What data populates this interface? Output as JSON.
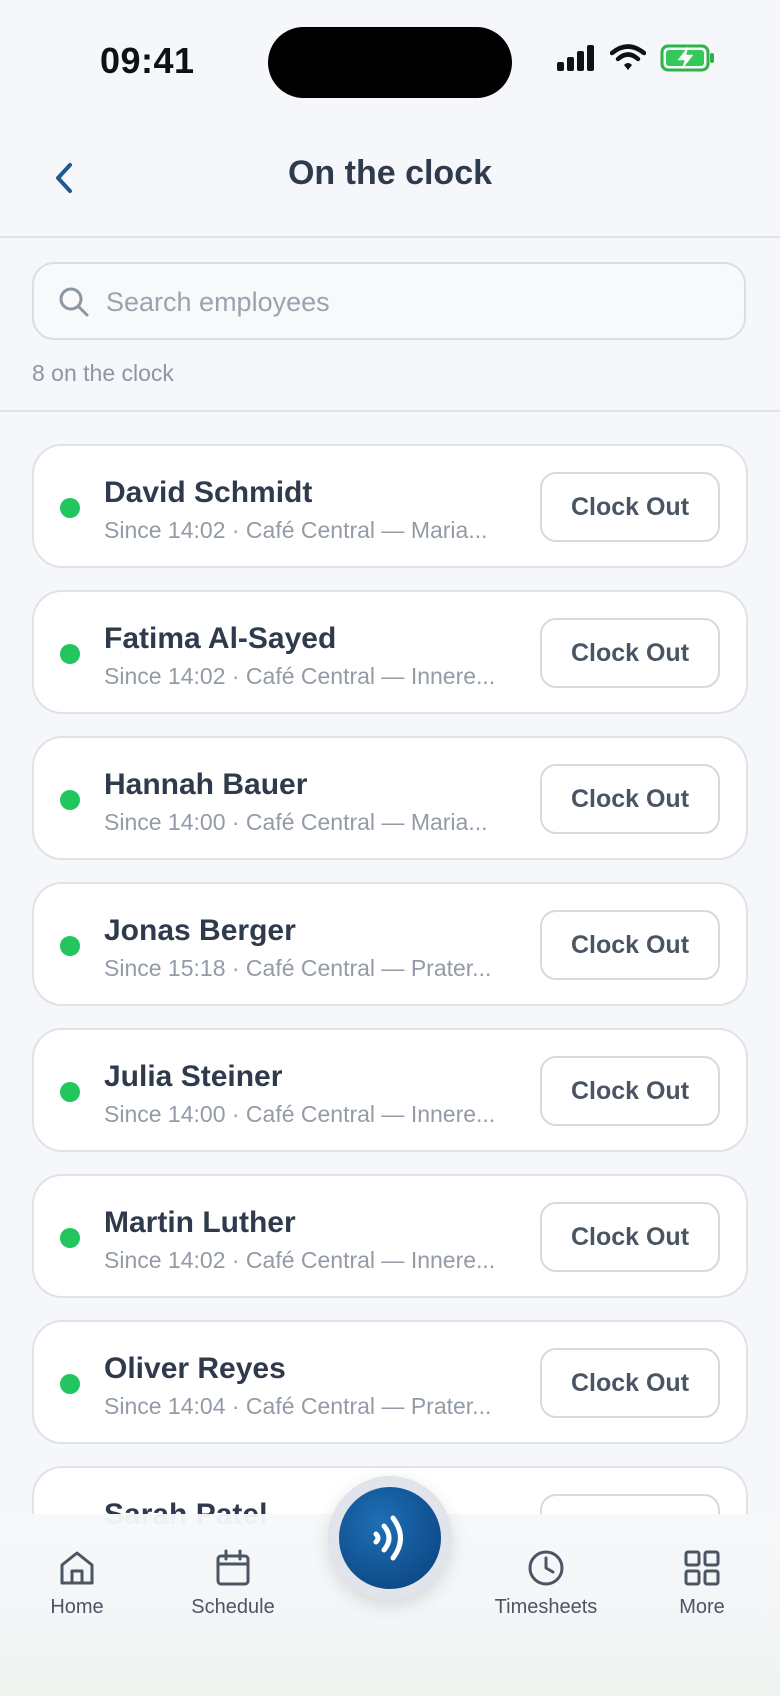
{
  "status_bar": {
    "time": "09:41"
  },
  "header": {
    "title": "On the clock"
  },
  "search": {
    "placeholder": "Search employees",
    "value": ""
  },
  "summary": {
    "count_label": "8 on the clock"
  },
  "employees": [
    {
      "name": "David Schmidt",
      "meta": "Since 14:02 · Café Central — Maria...",
      "action": "Clock Out"
    },
    {
      "name": "Fatima Al-Sayed",
      "meta": "Since 14:02 · Café Central — Innere...",
      "action": "Clock Out"
    },
    {
      "name": "Hannah Bauer",
      "meta": "Since 14:00 · Café Central — Maria...",
      "action": "Clock Out"
    },
    {
      "name": "Jonas Berger",
      "meta": "Since 15:18 · Café Central — Prater...",
      "action": "Clock Out"
    },
    {
      "name": "Julia Steiner",
      "meta": "Since 14:00 · Café Central — Innere...",
      "action": "Clock Out"
    },
    {
      "name": "Martin Luther",
      "meta": "Since 14:02 · Café Central — Innere...",
      "action": "Clock Out"
    },
    {
      "name": "Oliver Reyes",
      "meta": "Since 14:04 · Café Central — Prater...",
      "action": "Clock Out"
    }
  ],
  "partial_employee": {
    "name": "Sarah Patel"
  },
  "tabbar": {
    "home": "Home",
    "schedule": "Schedule",
    "timesheets": "Timesheets",
    "more": "More"
  },
  "colors": {
    "accent": "#0f4d8c",
    "active_dot": "#22c55e"
  }
}
